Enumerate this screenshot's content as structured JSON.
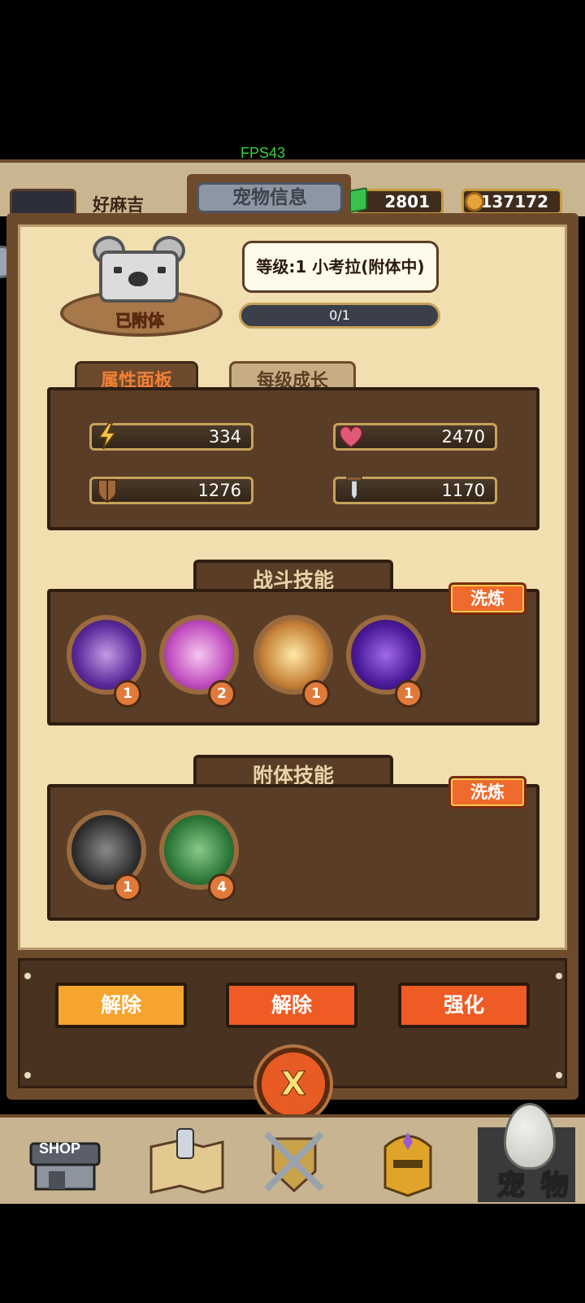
{
  "hud": {
    "fps": "FPS43",
    "player_name": "好麻吉",
    "title": "宠物信息",
    "gems": "2801",
    "coins": "137172"
  },
  "pet": {
    "level_label": "等级:1 小考拉(附体中)",
    "attached_label": "已附体",
    "xp": "0/1",
    "xp_progress": 0
  },
  "tabs": {
    "attributes": "属性面板",
    "growth": "每级成长"
  },
  "stats": {
    "energy": "334",
    "health": "2470",
    "defense": "1276",
    "attack": "1170"
  },
  "combat": {
    "title": "战斗技能",
    "refine": "洗炼",
    "skills": [
      {
        "icon": "dark-fist-icon",
        "level": "1"
      },
      {
        "icon": "purple-shield-icon",
        "level": "2"
      },
      {
        "icon": "balance-scale-icon",
        "level": "1"
      },
      {
        "icon": "void-rift-icon",
        "level": "1"
      }
    ]
  },
  "possession": {
    "title": "附体技能",
    "refine": "洗炼",
    "skills": [
      {
        "icon": "beast-fang-icon",
        "level": "1"
      },
      {
        "icon": "green-fist-icon",
        "level": "4"
      }
    ]
  },
  "actions": {
    "release1": "解除",
    "release2": "解除",
    "enhance": "强化",
    "close": "X"
  },
  "nav": {
    "shop_sign": "SHOP",
    "pet_label": "宠 物"
  },
  "colors": {
    "accent_orange": "#ef6a2c",
    "frame_brown": "#6e4a2c",
    "parchment": "#f1dfb0"
  }
}
